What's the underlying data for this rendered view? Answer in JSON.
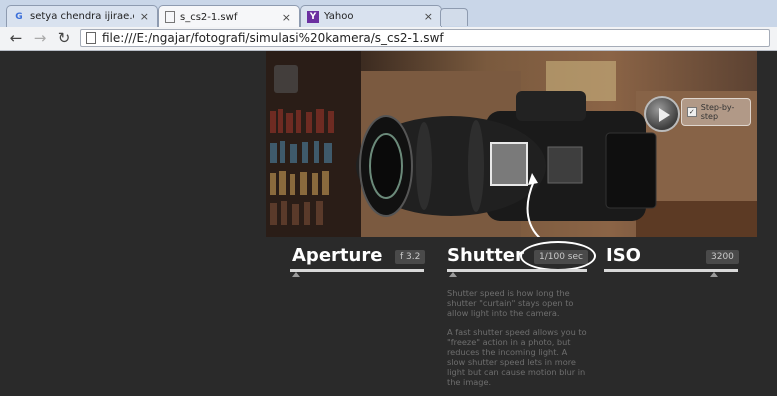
{
  "tabs": [
    {
      "label": "setya chendra ijirae.com -",
      "icon": "google-g-icon",
      "active": false
    },
    {
      "label": "s_cs2-1.swf",
      "icon": "page-icon",
      "active": true
    },
    {
      "label": "Yahoo",
      "icon": "yahoo-icon",
      "active": false
    }
  ],
  "toolbar": {
    "url": "file:///E:/ngajar/fotografi/simulasi%20kamera/s_cs2-1.swf"
  },
  "stage": {
    "step_label": "Step-by-step"
  },
  "controls": {
    "aperture": {
      "label": "Aperture",
      "value": "f 3.2"
    },
    "shutter": {
      "label": "Shutter",
      "value": "1/100 sec"
    },
    "iso": {
      "label": "ISO",
      "value": "3200"
    }
  },
  "description": {
    "p1": "Shutter speed is how long the shutter \"curtain\" stays open to allow light into the camera.",
    "p2": "A fast shutter speed allows you to \"freeze\" action in a photo, but reduces the incoming light. A slow shutter speed lets in more light but can cause motion blur in the image."
  },
  "colors": {
    "background": "#2a2a2a",
    "accent": "#ffffff"
  }
}
